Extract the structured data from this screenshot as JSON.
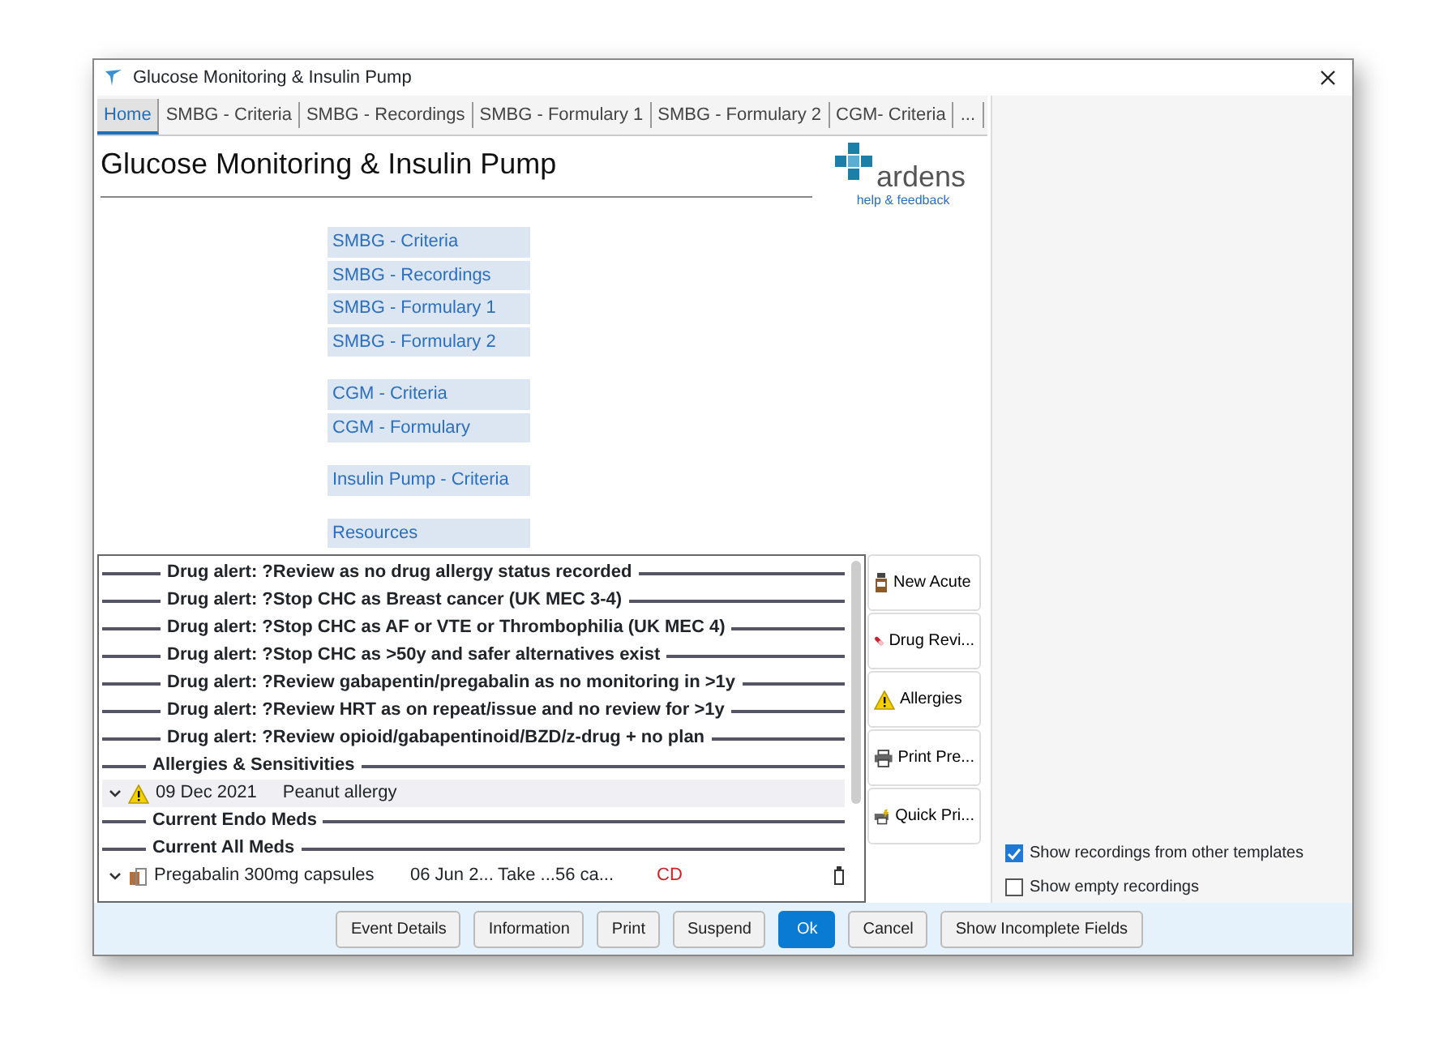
{
  "window": {
    "title": "Glucose Monitoring & Insulin Pump"
  },
  "tabs": [
    {
      "label": "Home",
      "selected": true
    },
    {
      "label": "SMBG - Criteria",
      "selected": false
    },
    {
      "label": "SMBG - Recordings",
      "selected": false
    },
    {
      "label": "SMBG - Formulary 1",
      "selected": false
    },
    {
      "label": "SMBG - Formulary 2",
      "selected": false
    },
    {
      "label": "CGM- Criteria",
      "selected": false
    },
    {
      "label": "...",
      "selected": false
    }
  ],
  "page": {
    "heading": "Glucose Monitoring & Insulin Pump",
    "logo_text": "ardens",
    "help_link": "help & feedback"
  },
  "menu_groups": [
    [
      "SMBG - Criteria",
      "SMBG - Recordings",
      "SMBG - Formulary 1",
      "SMBG - Formulary 2"
    ],
    [
      "CGM - Criteria",
      "CGM - Formulary"
    ],
    [
      "Insulin Pump - Criteria"
    ],
    [
      "Resources"
    ]
  ],
  "record_list": [
    {
      "kind": "alert",
      "text": "Drug alert: ?Review as no drug allergy status recorded"
    },
    {
      "kind": "alert",
      "text": "Drug alert: ?Stop CHC as Breast cancer (UK MEC 3-4)"
    },
    {
      "kind": "alert",
      "text": "Drug alert: ?Stop CHC as AF or VTE or Thrombophilia (UK MEC 4)"
    },
    {
      "kind": "alert",
      "text": "Drug alert: ?Stop CHC as >50y and safer alternatives exist"
    },
    {
      "kind": "alert",
      "text": "Drug alert: ?Review gabapentin/pregabalin as no monitoring in >1y"
    },
    {
      "kind": "alert",
      "text": "Drug alert: ?Review HRT as on repeat/issue and no review for >1y"
    },
    {
      "kind": "alert",
      "text": "Drug alert: ?Review opioid/gabapentinoid/BZD/z-drug + no plan"
    },
    {
      "kind": "section",
      "text": "Allergies & Sensitivities"
    },
    {
      "kind": "allergy",
      "date": "09 Dec 2021",
      "text": "Peanut allergy"
    },
    {
      "kind": "section",
      "text": "Current Endo Meds"
    },
    {
      "kind": "section",
      "text": "Current All Meds"
    },
    {
      "kind": "medication",
      "text": "Pregabalin 300mg capsules",
      "date": "06 Jun 2...",
      "dosage": "Take ...56 ca...",
      "flag": "CD"
    }
  ],
  "side_buttons": [
    {
      "kind": "bottle",
      "label": "New Acute"
    },
    {
      "kind": "pill",
      "label": "Drug Revi..."
    },
    {
      "kind": "warning",
      "label": "Allergies"
    },
    {
      "kind": "printer",
      "label": "Print Pre..."
    },
    {
      "kind": "quick-print",
      "label": "Quick Pri..."
    }
  ],
  "options": [
    {
      "label": "Show recordings from other templates",
      "checked": true
    },
    {
      "label": "Show empty recordings",
      "checked": false
    }
  ],
  "footer_buttons": [
    {
      "label": "Event Details",
      "primary": false
    },
    {
      "label": "Information",
      "primary": false
    },
    {
      "label": "Print",
      "primary": false
    },
    {
      "label": "Suspend",
      "primary": false
    },
    {
      "label": "Ok",
      "primary": true
    },
    {
      "label": "Cancel",
      "primary": false
    },
    {
      "label": "Show Incomplete Fields",
      "primary": false
    }
  ]
}
